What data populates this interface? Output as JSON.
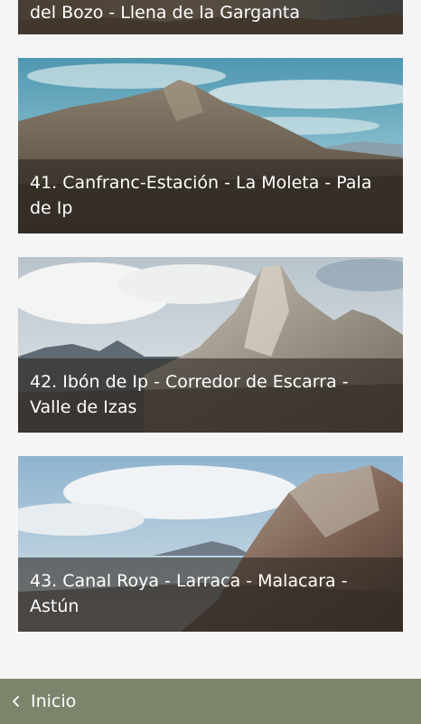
{
  "routes": [
    {
      "title": "del Bozo - Llena de la Garganta"
    },
    {
      "title": "41. Canfranc-Estación - La Moleta - Pala de Ip"
    },
    {
      "title": "42. Ibón de Ip - Corredor de Escarra - Valle de Izas"
    },
    {
      "title": "43. Canal Roya - Larraca - Malacara - Astún"
    }
  ],
  "bottom_bar": {
    "back_label": "Inicio",
    "back_icon": "chevron-left-icon",
    "background_color": "#7a856c"
  }
}
